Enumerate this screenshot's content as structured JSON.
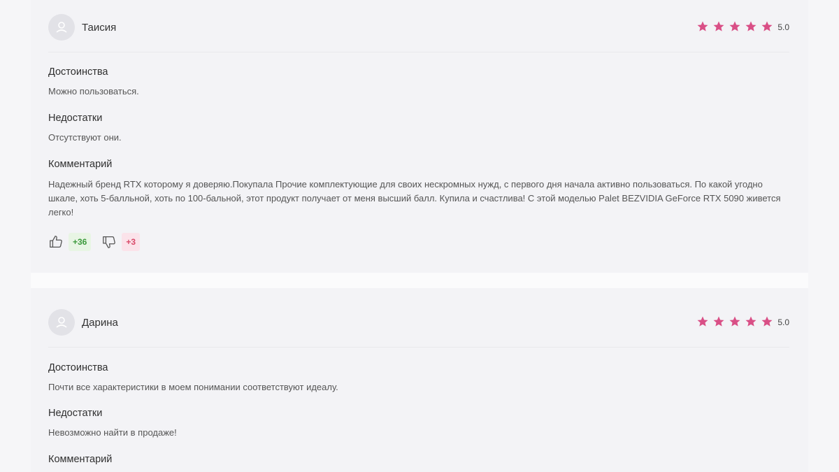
{
  "colors": {
    "star": "#d94f86",
    "like_badge_bg": "#e8f5e4",
    "like_badge_text": "#3d9a3d",
    "dislike_badge_bg": "#fbe3ea",
    "dislike_badge_text": "#d94a6a"
  },
  "reviews": [
    {
      "author": "Таисия",
      "avatar_icon": "user-icon",
      "stars": 5,
      "rating": "5.0",
      "pros_title": "Достоинства",
      "pros": "Можно пользоваться.",
      "cons_title": "Недостатки",
      "cons": "Отсутствуют они.",
      "comment_title": "Комментарий",
      "comment": "Надежный бренд RTX которому я доверяю.Покупала Прочие комплектующие для своих нескромных нужд, с первого дня начала активно пользоваться. По какой угодно шкале, хоть 5-балльной, хоть по 100-бальной, этот продукт получает от меня высший балл. Купила и счастлива! С этой моделью Palet BEZVIDIA GeForce RTX 5090 живется легко!",
      "likes": "+36",
      "dislikes": "+3",
      "like_icon": "thumbs-up-icon",
      "dislike_icon": "thumbs-down-icon"
    },
    {
      "author": "Дарина",
      "avatar_icon": "user-icon",
      "stars": 5,
      "rating": "5.0",
      "pros_title": "Достоинства",
      "pros": "Почти все характеристики в моем понимании соответствуют идеалу.",
      "cons_title": "Недостатки",
      "cons": "Невозможно найти в продаже!",
      "comment_title": "Комментарий"
    }
  ]
}
